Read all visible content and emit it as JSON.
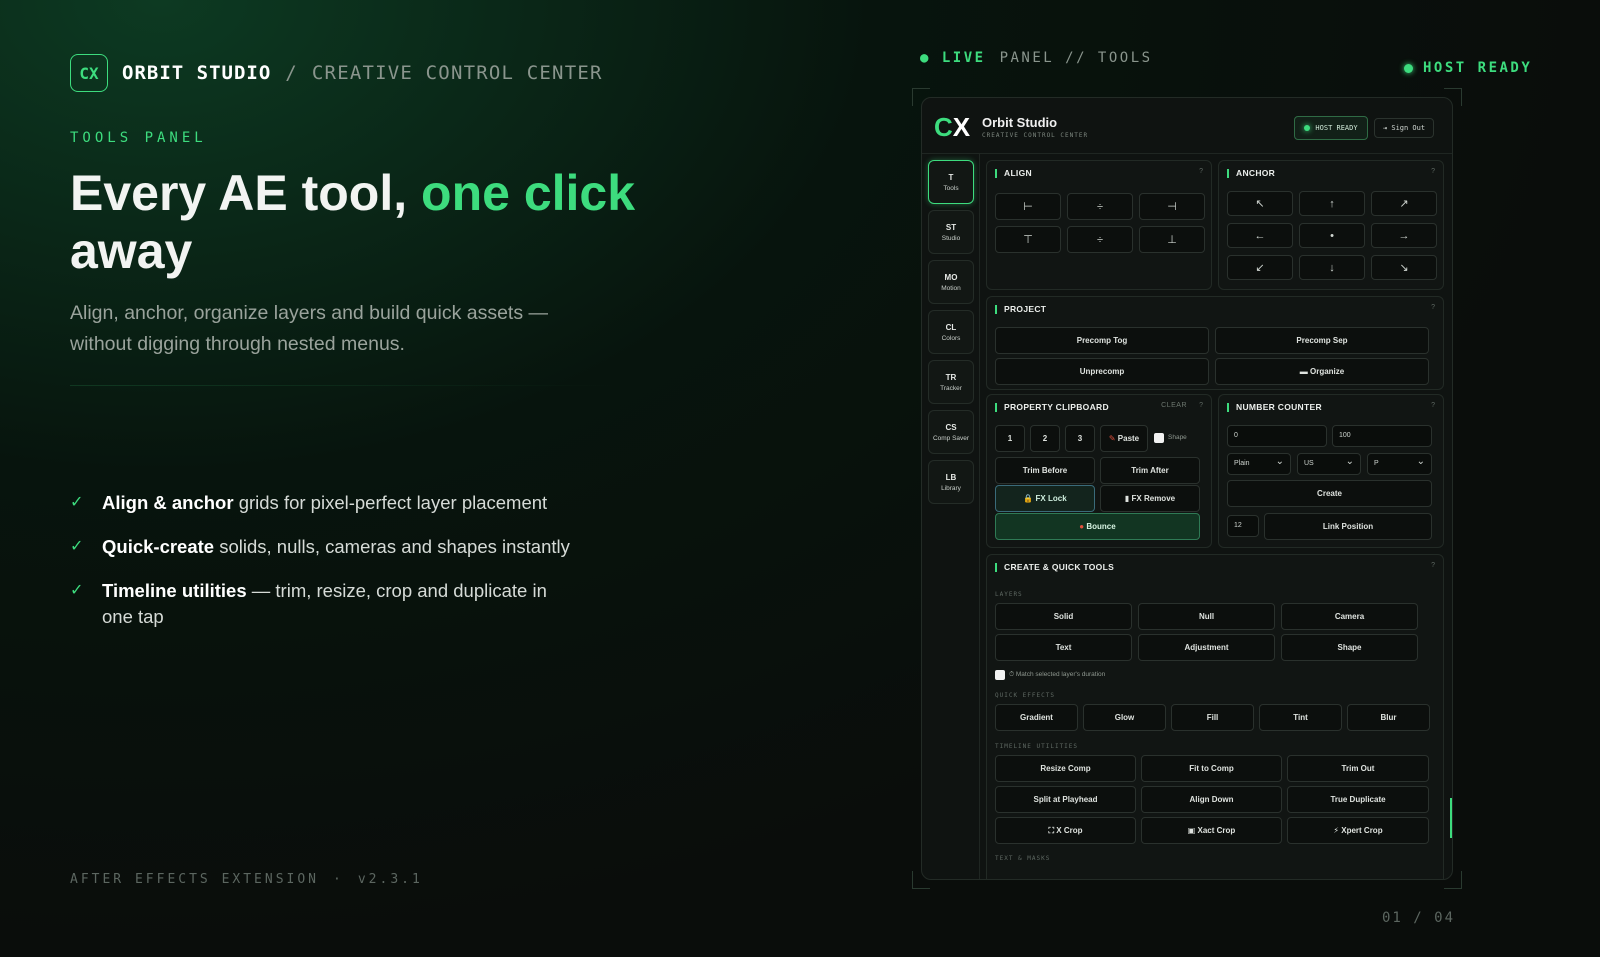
{
  "brand": {
    "logo": "CX",
    "name": "ORBIT STUDIO",
    "sep": "/",
    "subtitle": "CREATIVE CONTROL CENTER"
  },
  "hero": {
    "eyebrow": "TOOLS PANEL",
    "headline_a": "Every AE tool, ",
    "headline_accent": "one click",
    "headline_b": "away",
    "lede": "Align, anchor, organize layers and build quick assets — without digging through nested menus."
  },
  "features": [
    {
      "strong": "Align & anchor",
      "rest": " grids for pixel-perfect layer placement"
    },
    {
      "strong": "Quick-create",
      "rest": " solids, nulls, cameras and shapes instantly"
    },
    {
      "strong": "Timeline utilities",
      "rest": " — trim, resize, crop and duplicate in one tap"
    }
  ],
  "footer": {
    "product": "AFTER EFFECTS EXTENSION",
    "dot": "·",
    "version": "v2.3.1",
    "page": "01 / 04"
  },
  "topbar": {
    "live": "LIVE",
    "panel": "PANEL // TOOLS",
    "host": "HOST READY"
  },
  "panel": {
    "logo_c": "C",
    "logo_x": "X",
    "title": "Orbit Studio",
    "subtitle": "CREATIVE CONTROL CENTER",
    "host_btn": "HOST READY",
    "signout": "⇥ Sign Out",
    "rail": [
      {
        "code": "T",
        "label": "Tools"
      },
      {
        "code": "ST",
        "label": "Studio"
      },
      {
        "code": "MO",
        "label": "Motion"
      },
      {
        "code": "CL",
        "label": "Colors"
      },
      {
        "code": "TR",
        "label": "Tracker"
      },
      {
        "code": "CS",
        "label": "Comp Saver"
      },
      {
        "code": "LB",
        "label": "Library"
      }
    ],
    "align": {
      "title": "ALIGN",
      "q": "?",
      "icons": [
        "⊢",
        "÷",
        "⊣",
        "⊤",
        "÷",
        "⊥"
      ]
    },
    "anchor": {
      "title": "ANCHOR",
      "q": "?",
      "icons": [
        "↖",
        "↑",
        "↗",
        "←",
        "•",
        "→",
        "↙",
        "↓",
        "↘"
      ]
    },
    "project": {
      "title": "PROJECT",
      "q": "?",
      "buttons": [
        "Precomp Tog",
        "Precomp Sep",
        "Unprecomp",
        "▬ Organize"
      ]
    },
    "clipboard": {
      "title": "PROPERTY CLIPBOARD",
      "clear": "CLEAR",
      "q": "?",
      "slots": [
        "1",
        "2",
        "3"
      ],
      "paste": "Paste",
      "paste_icon": "✎",
      "shape_label": "Shape",
      "trim_before": "Trim Before",
      "trim_after": "Trim After",
      "fx_lock": "🔒 FX Lock",
      "fx_remove": "▮ FX Remove",
      "bounce": "Bounce",
      "bounce_icon": "●"
    },
    "counter": {
      "title": "NUMBER COUNTER",
      "q": "?",
      "from": "0",
      "to": "100",
      "format": "Plain",
      "locale": "US",
      "mode": "P",
      "create": "Create",
      "decimals": "12",
      "link": "Link Position"
    },
    "create": {
      "title": "CREATE & QUICK TOOLS",
      "q": "?",
      "layers_label": "LAYERS",
      "layers": [
        "Solid",
        "Null",
        "Camera",
        "Text",
        "Adjustment",
        "Shape"
      ],
      "match_label": "⏱ Match selected layer's duration",
      "effects_label": "QUICK EFFECTS",
      "effects": [
        "Gradient",
        "Glow",
        "Fill",
        "Tint",
        "Blur"
      ],
      "timeline_label": "TIMELINE UTILITIES",
      "timeline": [
        "Resize Comp",
        "Fit to Comp",
        "Trim Out",
        "Split at Playhead",
        "Align Down",
        "True Duplicate",
        "⛶ X Crop",
        "▣ Xact Crop",
        "⚡ Xpert Crop"
      ],
      "next_label": "TEXT & MASKS"
    }
  }
}
